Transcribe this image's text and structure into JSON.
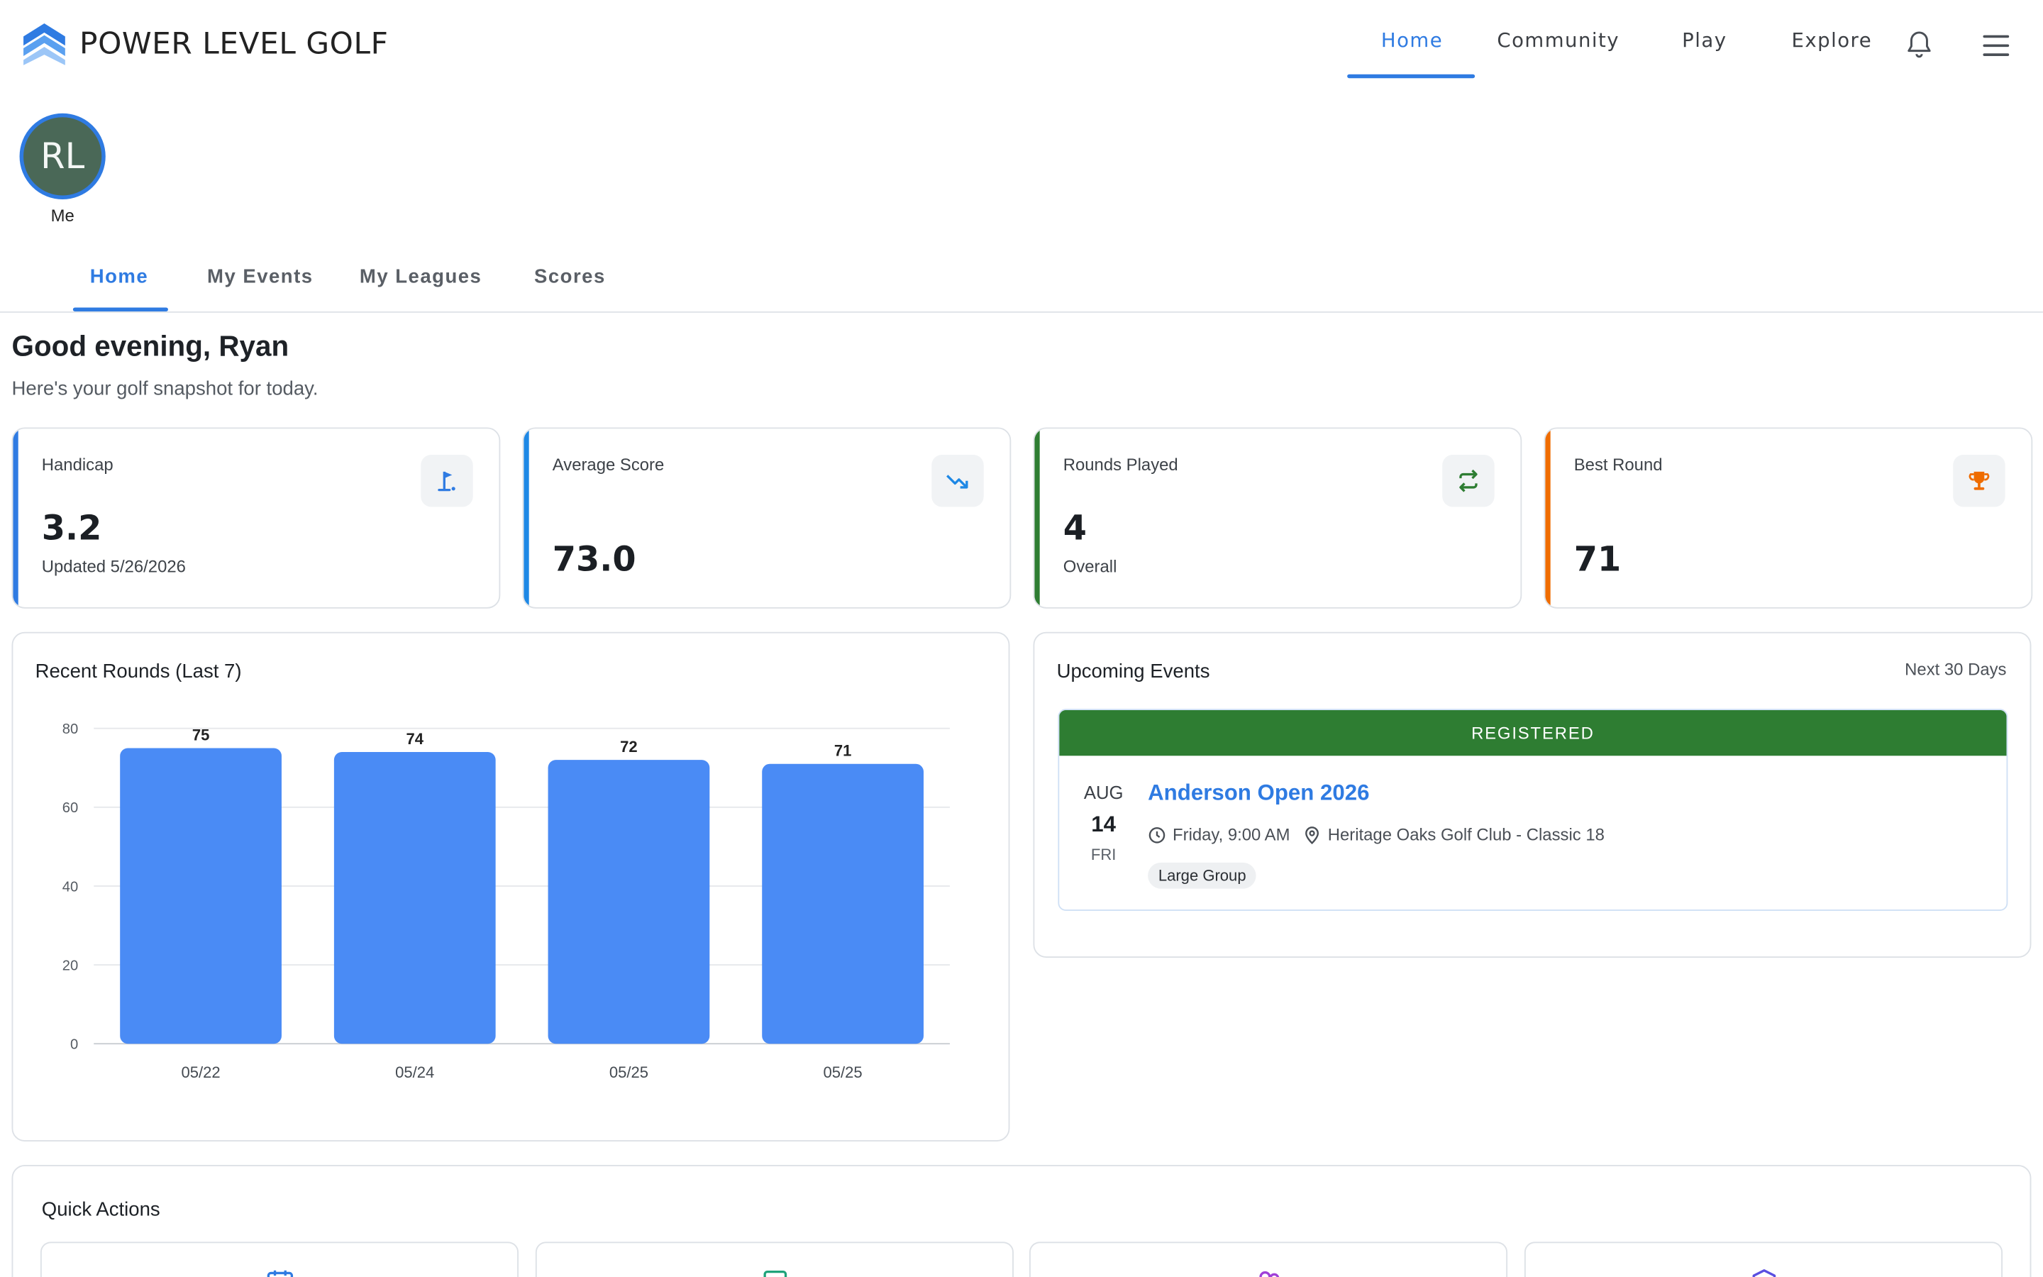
{
  "app": {
    "name": "POWER LEVEL GOLF"
  },
  "nav": {
    "items": [
      {
        "label": "Home"
      },
      {
        "label": "Community"
      },
      {
        "label": "Play"
      },
      {
        "label": "Explore"
      }
    ],
    "active": "Home",
    "icons": [
      "bell-icon",
      "hamburger-menu-icon"
    ]
  },
  "profile": {
    "initials": "RL",
    "label": "Me",
    "avatar_color": "#4a6857"
  },
  "subtabs": {
    "items": [
      {
        "label": "Home"
      },
      {
        "label": "My Events"
      },
      {
        "label": "My Leagues"
      },
      {
        "label": "Scores"
      }
    ],
    "active": "Home"
  },
  "greeting": {
    "title": "Good evening, Ryan",
    "subtitle": "Here's your golf snapshot for today."
  },
  "stats": [
    {
      "label": "Handicap",
      "value": "3.2",
      "note": "Updated 5/26/2026",
      "icon": "golf-flag-icon",
      "accent": "#2f7be2"
    },
    {
      "label": "Average Score",
      "value": "73.0",
      "note": "",
      "icon": "trending-down-icon",
      "accent": "#1e88e5"
    },
    {
      "label": "Rounds Played",
      "value": "4",
      "note": "Overall",
      "icon": "repeat-icon",
      "accent": "#2e7d32"
    },
    {
      "label": "Best Round",
      "value": "71",
      "note": "",
      "icon": "trophy-icon",
      "accent": "#ef6c00"
    }
  ],
  "recent_rounds": {
    "title": "Recent Rounds (Last 7)"
  },
  "chart_data": {
    "type": "bar",
    "categories": [
      "05/22",
      "05/24",
      "05/25",
      "05/25"
    ],
    "values": [
      75,
      74,
      72,
      71
    ],
    "title": "Recent Rounds (Last 7)",
    "xlabel": "",
    "ylabel": "",
    "ylim": [
      0,
      80
    ],
    "yticks": [
      0,
      20,
      40,
      60,
      80
    ],
    "grid": true,
    "bar_color": "#4a8bf5",
    "data_labels": true
  },
  "events": {
    "title": "Upcoming Events",
    "range": "Next 30 Days",
    "items": [
      {
        "status": "REGISTERED",
        "month": "AUG",
        "day": "14",
        "dow": "FRI",
        "name": "Anderson Open 2026",
        "time": "Friday, 9:00 AM",
        "venue": "Heritage Oaks Golf Club - Classic 18",
        "tag": "Large Group",
        "status_color": "#2e7d32"
      }
    ]
  },
  "quick_actions": {
    "title": "Quick Actions",
    "icons": [
      "calendar-icon",
      "tablet-icon",
      "people-icon",
      "shield-icon"
    ]
  }
}
